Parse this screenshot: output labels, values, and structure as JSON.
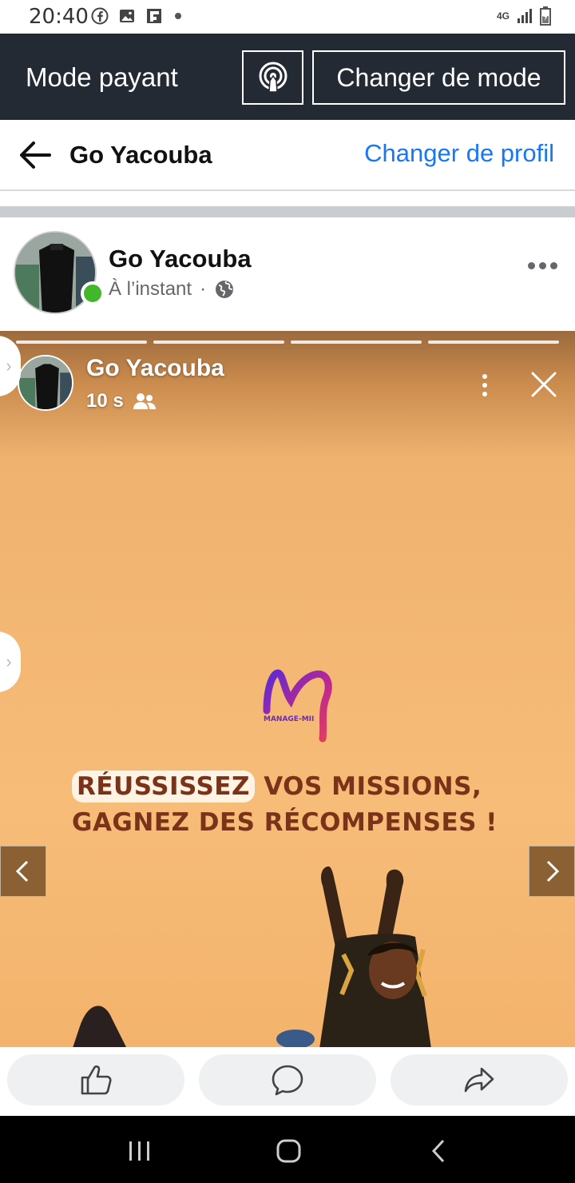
{
  "status_bar": {
    "time": "20:40",
    "network": "4G",
    "icons": [
      "facebook-icon",
      "image-icon",
      "flipboard-icon",
      "notification-dot",
      "signal-icon",
      "battery-icon"
    ]
  },
  "mode_bar": {
    "title": "Mode payant",
    "change_mode_label": "Changer de mode",
    "background": "#242a34"
  },
  "profile_header": {
    "name": "Go Yacouba",
    "switch_profile_label": "Changer de profil",
    "link_color": "#1877f2"
  },
  "post": {
    "author": "Go Yacouba",
    "timestamp": "À l’instant",
    "separator": "·",
    "audience": "public-globe-icon"
  },
  "story": {
    "author": "Go Yacouba",
    "elapsed": "10 s",
    "progress_segments": 4,
    "brand": "MANAGE-MII",
    "headline_highlight": "RÉUSSISSEZ",
    "headline_rest": "VOS MISSIONS,",
    "headline_line2": "GAGNEZ DES RÉCOMPENSES !"
  },
  "actions": [
    "like-icon",
    "comment-icon",
    "share-icon"
  ]
}
